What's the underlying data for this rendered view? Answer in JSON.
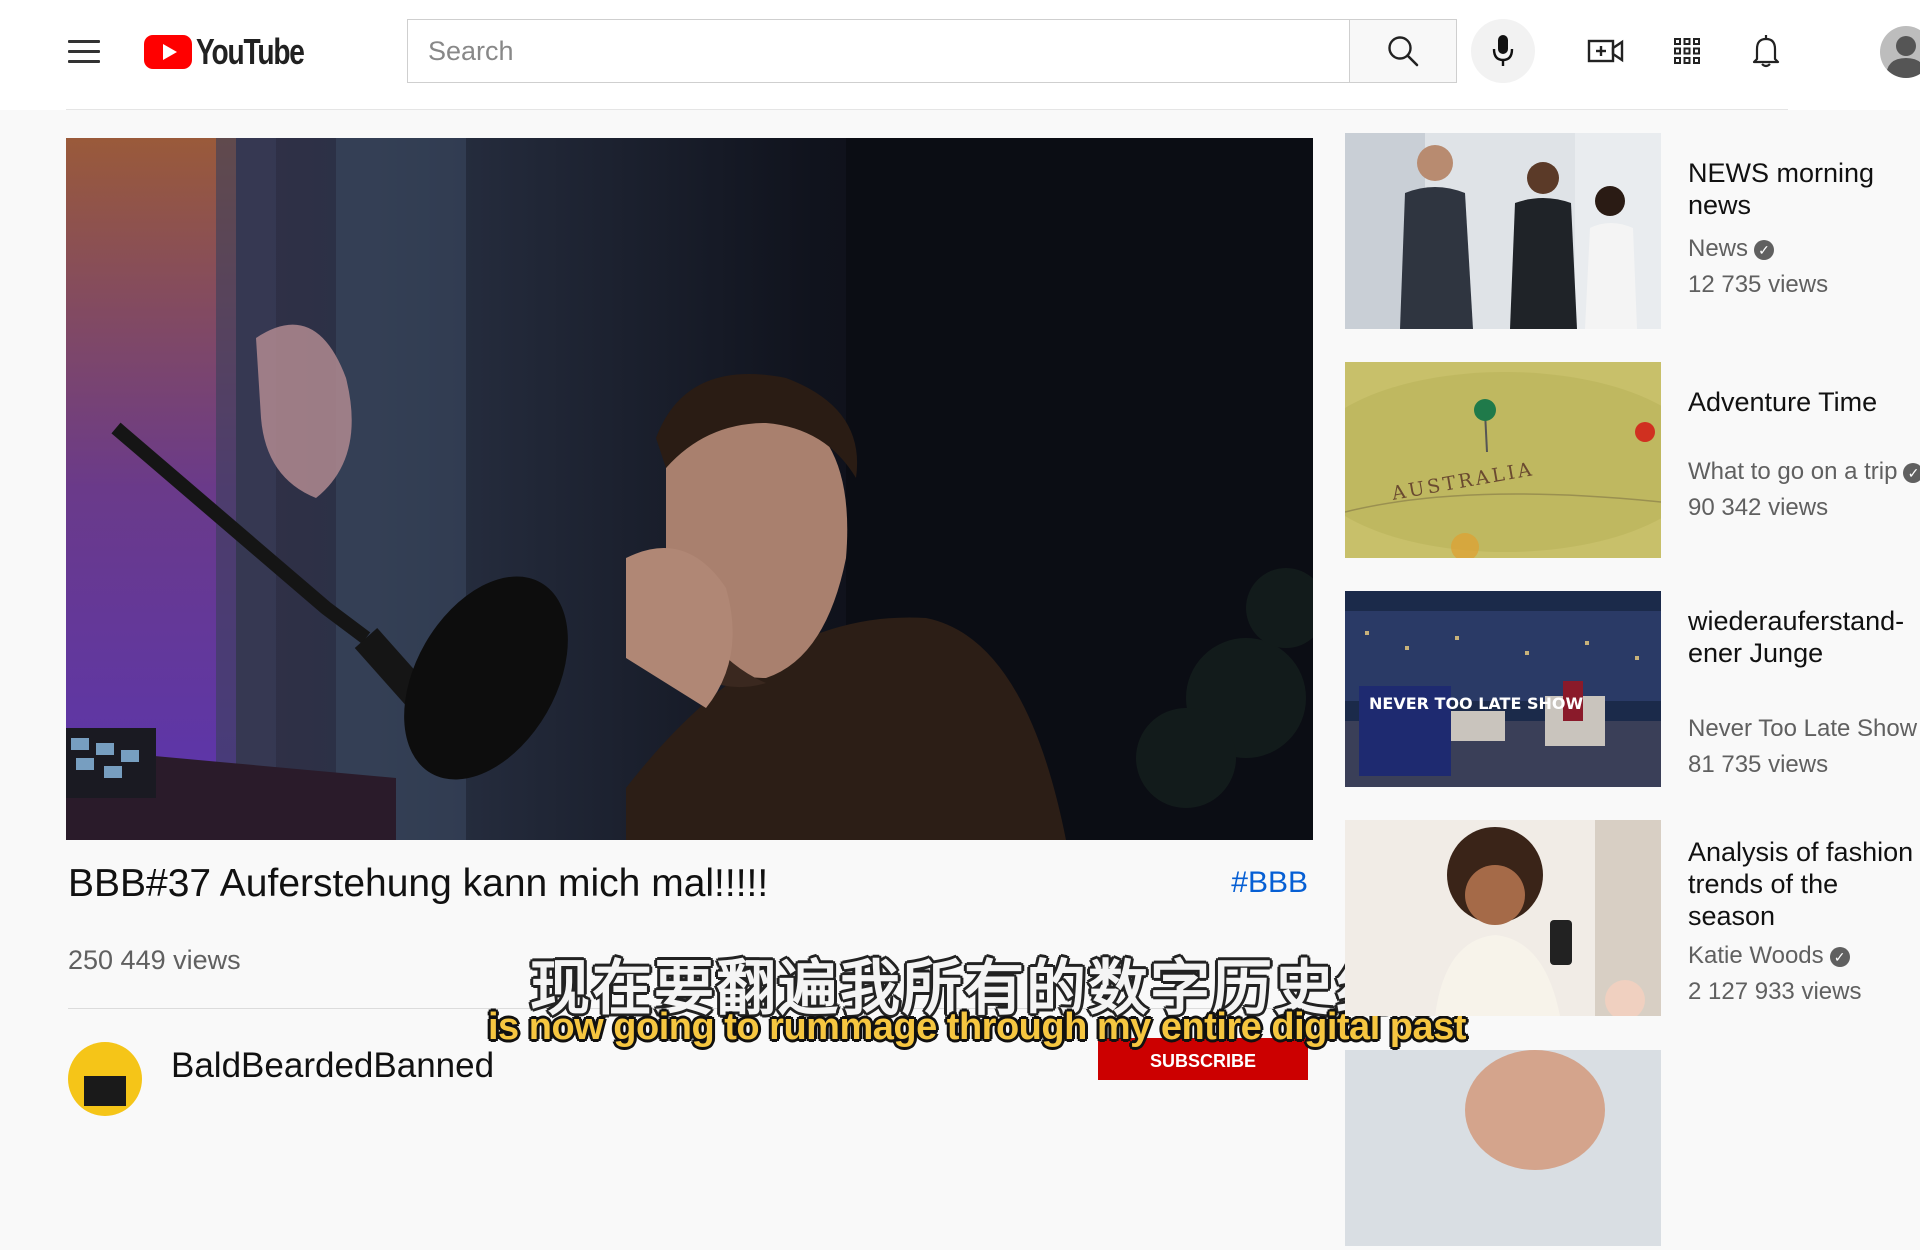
{
  "header": {
    "logo_text": "YouTube",
    "search_placeholder": "Search"
  },
  "video": {
    "title": "BBB#37 Auferstehung kann mich mal!!!!!",
    "hashtag": "#BBB",
    "views": "250 449 views",
    "channel": "BaldBeardedBanned",
    "subscribe_label": "SUBSCRIBE"
  },
  "subtitles": {
    "chinese": "现在要翻遍我所有的数字历史纪录",
    "english": "is now going to rummage through my entire digital past"
  },
  "recommendations": [
    {
      "title": "NEWS morning news",
      "channel": "News",
      "verified": true,
      "views": "12 735 views"
    },
    {
      "title": "Adventure Time",
      "channel": "What to go on a trip",
      "verified": true,
      "views": "90 342 views"
    },
    {
      "title": "wiederauferstand-ener Junge",
      "channel": "Never Too Late Show",
      "verified": false,
      "views": "81 735 views"
    },
    {
      "title": "Analysis of fashion trends of the season",
      "channel": "Katie Woods",
      "verified": true,
      "views": "2 127 933 views"
    }
  ],
  "thumb_text": {
    "map_label": "AUSTRALIA",
    "show_logo": "NEVER TOO LATE SHOW"
  },
  "colors": {
    "brand_red": "#ff0000",
    "link_blue": "#065fd4",
    "subtitle_yellow": "#f6c640"
  }
}
